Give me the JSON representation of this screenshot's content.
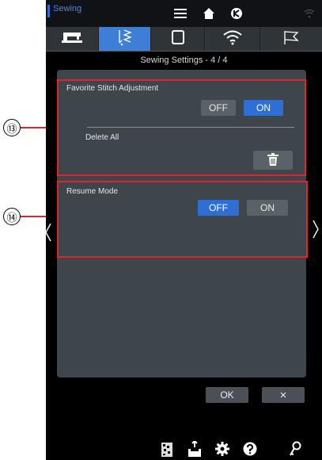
{
  "status_bar": {
    "mode_label": "Sewing"
  },
  "tabs": [
    {
      "name": "machine-tab",
      "icon": "sewing-machine-icon",
      "active": false
    },
    {
      "name": "stitch-tab",
      "icon": "stitch-icon",
      "active": true
    },
    {
      "name": "screen-tab",
      "icon": "screen-icon",
      "active": false
    },
    {
      "name": "wireless-tab",
      "icon": "wifi-icon",
      "active": false
    },
    {
      "name": "flag-tab",
      "icon": "flag-icon",
      "active": false
    }
  ],
  "screen": {
    "title": "Sewing Settings - 4 / 4"
  },
  "favorite_stitch": {
    "label": "Favorite Stitch Adjustment",
    "off_label": "OFF",
    "on_label": "ON",
    "selected": "ON",
    "delete_all_label": "Delete All"
  },
  "resume_mode": {
    "label": "Resume Mode",
    "off_label": "OFF",
    "on_label": "ON",
    "selected": "OFF"
  },
  "actions": {
    "ok_label": "OK",
    "cancel_label": "×"
  },
  "callouts": {
    "c13": "⑬",
    "c14": "⑭"
  },
  "colors": {
    "accent": "#2e6fd6",
    "frame": "#e3232b",
    "panel": "#3f464b"
  }
}
